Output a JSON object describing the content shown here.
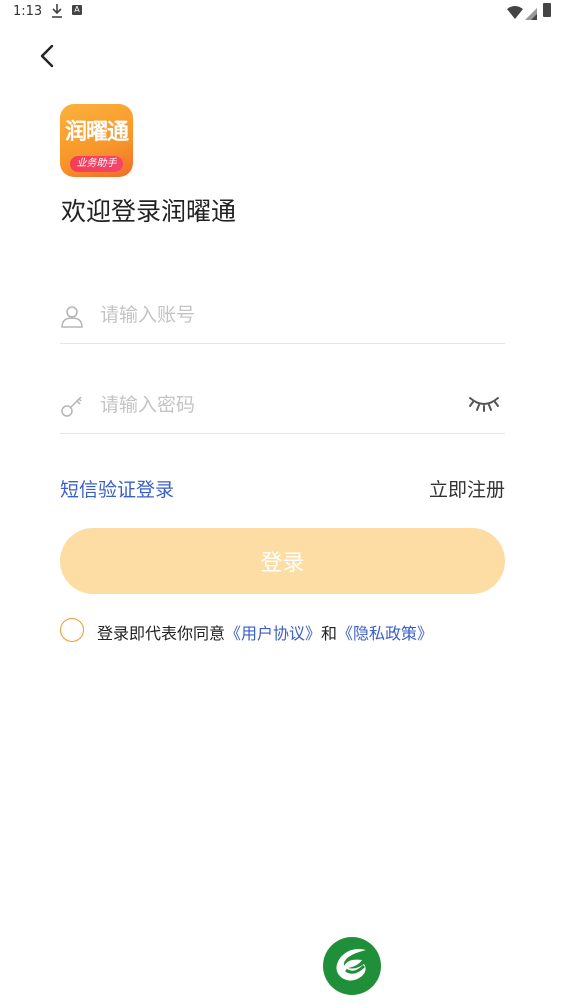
{
  "status_bar": {
    "time": "1:13",
    "a_badge": "A"
  },
  "app": {
    "logo_text": "润曜通",
    "logo_subtext": "业务助手",
    "welcome": "欢迎登录润曜通"
  },
  "account": {
    "placeholder": "请输入账号",
    "value": ""
  },
  "password": {
    "placeholder": "请输入密码",
    "value": ""
  },
  "links": {
    "sms_login": "短信验证登录",
    "register": "立即注册"
  },
  "login_button": "登录",
  "agreement": {
    "prefix": "登录即代表你同意",
    "user_agreement": "《用户协议》",
    "and": "和",
    "privacy_policy": "《隐私政策》",
    "checked": false
  },
  "colors": {
    "accent": "#f19a31",
    "link": "#3a5fc8",
    "button_disabled": "#fddda3",
    "brand_green": "#1f8f3a"
  },
  "icons": [
    "download-icon",
    "wifi-icon",
    "signal-icon",
    "battery-icon",
    "back-arrow-icon",
    "user-icon",
    "key-icon",
    "eye-closed-icon",
    "brand-leaf-icon"
  ]
}
